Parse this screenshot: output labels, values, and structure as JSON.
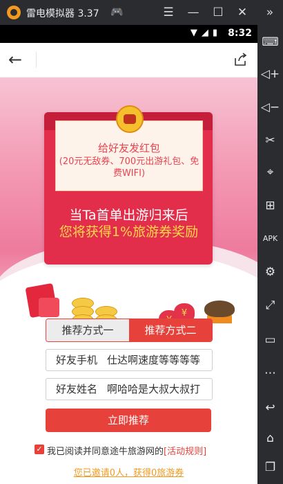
{
  "emulator": {
    "title": "雷电模拟器 3.37",
    "game_icon": "gamepad-icon",
    "window_buttons": [
      "menu-icon",
      "minimize-icon",
      "maximize-icon",
      "close-icon",
      "collapse-icon"
    ]
  },
  "statusbar": {
    "time": "8:32",
    "icons": [
      "wifi-icon",
      "signal-icon",
      "battery-icon"
    ]
  },
  "sidebar": {
    "tools": [
      "keyboard-icon",
      "volume-up-icon",
      "volume-down-icon",
      "scissors-icon",
      "location-icon",
      "add-window-icon",
      "apk-icon",
      "settings-icon",
      "fullscreen-icon",
      "screen-icon",
      "more-icon",
      "back-icon",
      "home-icon",
      "recent-apps-icon"
    ]
  },
  "nav": {
    "back_glyph": "←",
    "share_icon": "share-icon"
  },
  "banner": {
    "card_title": "给好友发红包",
    "card_detail": "(20元无敌券、700元出游礼包、免费WIFI)",
    "headline": "当Ta首单出游归来后",
    "reward": "您将获得1%旅游券奖励",
    "coin_symbol": "¥"
  },
  "tabs": [
    "推荐方式一",
    "推荐方式二"
  ],
  "form": {
    "phone_label": "好友手机",
    "phone_value": "仕达啊速度等等等等",
    "name_label": "好友姓名",
    "name_value": "啊哈哈是大叔大叔打",
    "submit_label": "立即推荐"
  },
  "agreement": {
    "check": "✓",
    "text": "我已阅读并同意途牛旅游网的",
    "rules_link": "[活动规则]"
  },
  "invite_status": "您已邀请0人，获得0旅游券",
  "colors": {
    "accent": "#e6413a",
    "banner_pink": "#f49cb6",
    "envelope_red": "#e22d4b",
    "reward_yellow": "#ffd84a",
    "link_orange": "#f29a1f"
  }
}
